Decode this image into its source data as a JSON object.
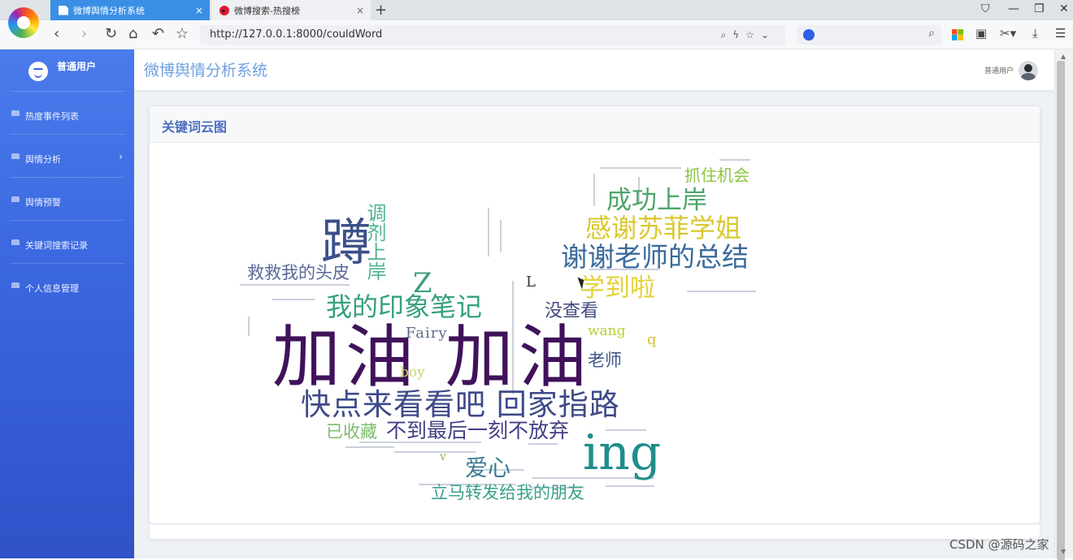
{
  "browser": {
    "tabs": [
      {
        "title": "微博舆情分析系统",
        "close": "×"
      },
      {
        "title": "微博搜索-热搜榜",
        "close": "×"
      }
    ],
    "new_tab": "+",
    "address": "http://127.0.0.1:8000/couldWord"
  },
  "sidebar": {
    "username": "普通用户",
    "items": [
      {
        "label": "热度事件列表"
      },
      {
        "label": "舆情分析",
        "chevron": "›"
      },
      {
        "label": "舆情预警"
      },
      {
        "label": "关键词搜索记录"
      },
      {
        "label": "个人信息管理"
      }
    ]
  },
  "header": {
    "title": "微博舆情分析系统",
    "user": "普通用户"
  },
  "card": {
    "title": "关键词云图"
  },
  "wordcloud": [
    {
      "text": "加油 加油",
      "color": "#40125a"
    },
    {
      "text": "快点来看看吧 回家指路",
      "color": "#3e4a89"
    },
    {
      "text": "不到最后一刻不放弃",
      "color": "#423f85"
    },
    {
      "text": "ing",
      "color": "#1f8d8a"
    },
    {
      "text": "蹲",
      "color": "#3b4f8a"
    },
    {
      "text": "我的印象笔记",
      "color": "#35a07e"
    },
    {
      "text": "谢谢老师的总结",
      "color": "#3a6a9b"
    },
    {
      "text": "感谢苏菲学姐",
      "color": "#d9c82f"
    },
    {
      "text": "成功上岸",
      "color": "#4ea56a"
    },
    {
      "text": "抓住机会",
      "color": "#8cc63f"
    },
    {
      "text": "学到啦",
      "color": "#e3d23a"
    },
    {
      "text": "救救我的头皮",
      "color": "#5a6996"
    },
    {
      "text": "调剂上岸",
      "color": "#4fb48e"
    },
    {
      "text": "Z",
      "color": "#3ba079"
    },
    {
      "text": "L",
      "color": "#333333"
    },
    {
      "text": "没查看",
      "color": "#404a7e"
    },
    {
      "text": "Fairy",
      "color": "#5b6c86"
    },
    {
      "text": "wang",
      "color": "#b8cd3a"
    },
    {
      "text": "q",
      "color": "#d4c52c"
    },
    {
      "text": "老师",
      "color": "#3e5587"
    },
    {
      "text": "boy",
      "color": "#c8d46a"
    },
    {
      "text": "已收藏",
      "color": "#7cbc6b"
    },
    {
      "text": "爱心",
      "color": "#3b7a93"
    },
    {
      "text": "v",
      "color": "#8fb845"
    },
    {
      "text": "立马转发给我的朋友",
      "color": "#39a28c"
    }
  ],
  "watermark": "CSDN @源码之家"
}
